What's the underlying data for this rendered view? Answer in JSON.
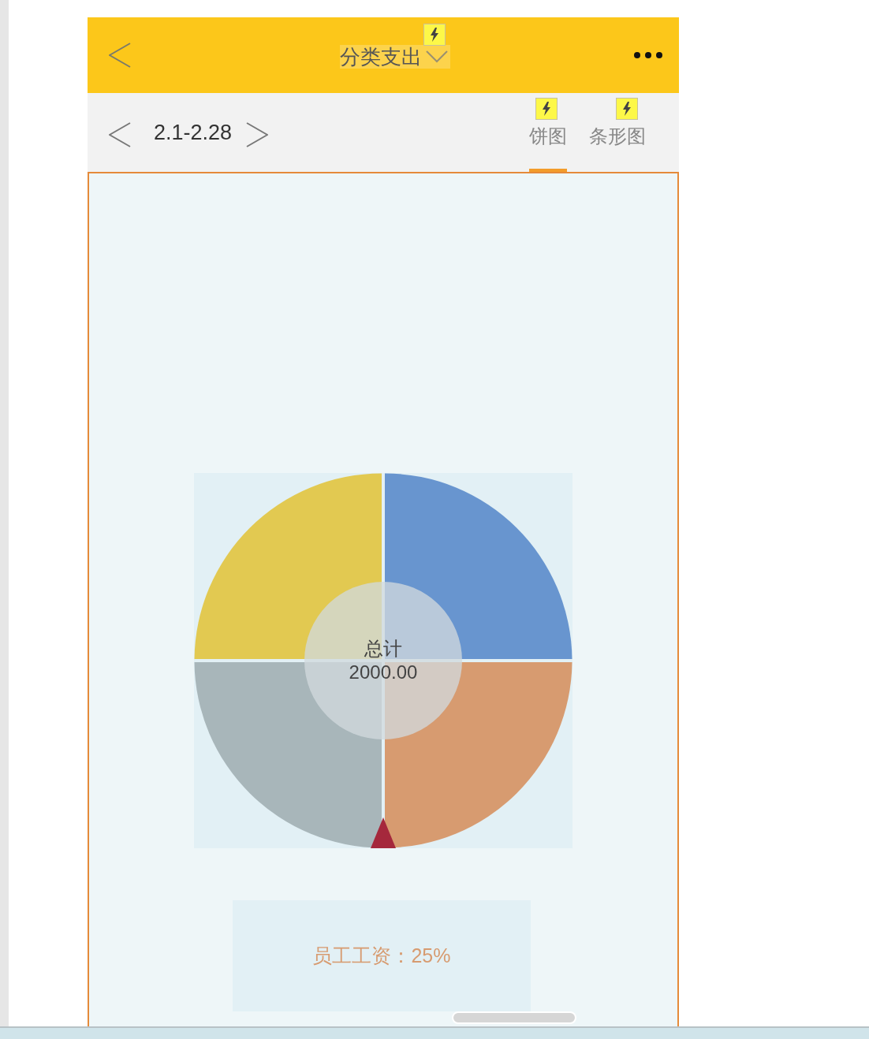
{
  "header": {
    "title": "分类支出"
  },
  "date_nav": {
    "range": "2.1-2.28"
  },
  "tabs": [
    {
      "label": "饼图",
      "selected": true
    },
    {
      "label": "条形图",
      "selected": false
    }
  ],
  "chart": {
    "center_label": "总计",
    "total": "2000.00",
    "slice_label": "员工工资：25%"
  }
}
